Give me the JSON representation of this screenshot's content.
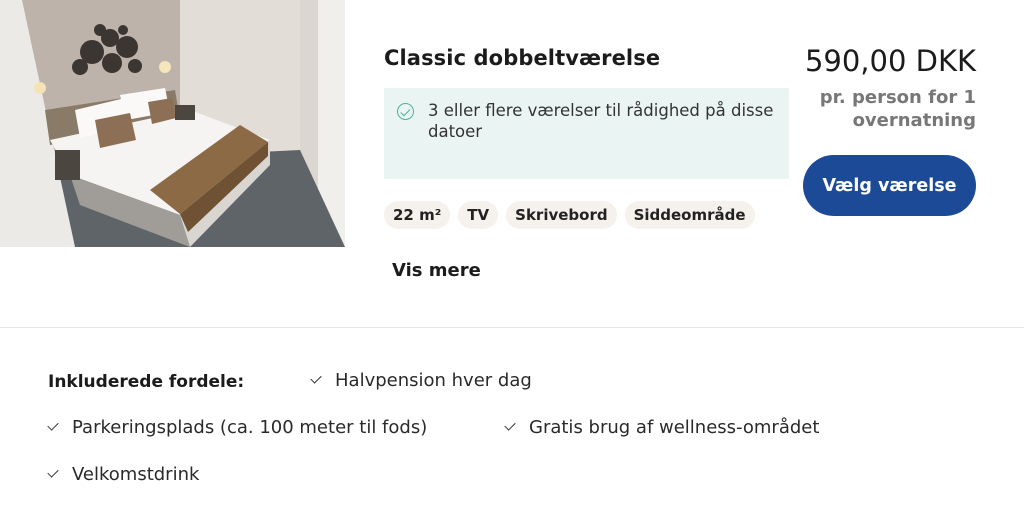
{
  "room": {
    "title": "Classic dobbeltværelse",
    "availability": "3 eller flere værelser til rådighed på disse datoer",
    "tags": [
      "22 m²",
      "TV",
      "Skrivebord",
      "Siddeområde"
    ],
    "more_link": "Vis mere"
  },
  "pricing": {
    "price": "590,00 DKK",
    "per_person": "pr. person for 1 overnatning",
    "select_button": "Vælg værelse"
  },
  "benefits": {
    "label": "Inkluderede fordele:",
    "items": [
      "Halvpension hver dag",
      "Parkeringsplads (ca. 100 meter til fods)",
      "Gratis brug af wellness-området",
      "Velkomstdrink"
    ]
  },
  "colors": {
    "button": "#1c4a97",
    "availability_bg": "#eaf4f2",
    "availability_check": "#4fb29c",
    "tag_bg": "#f5f1ec"
  }
}
